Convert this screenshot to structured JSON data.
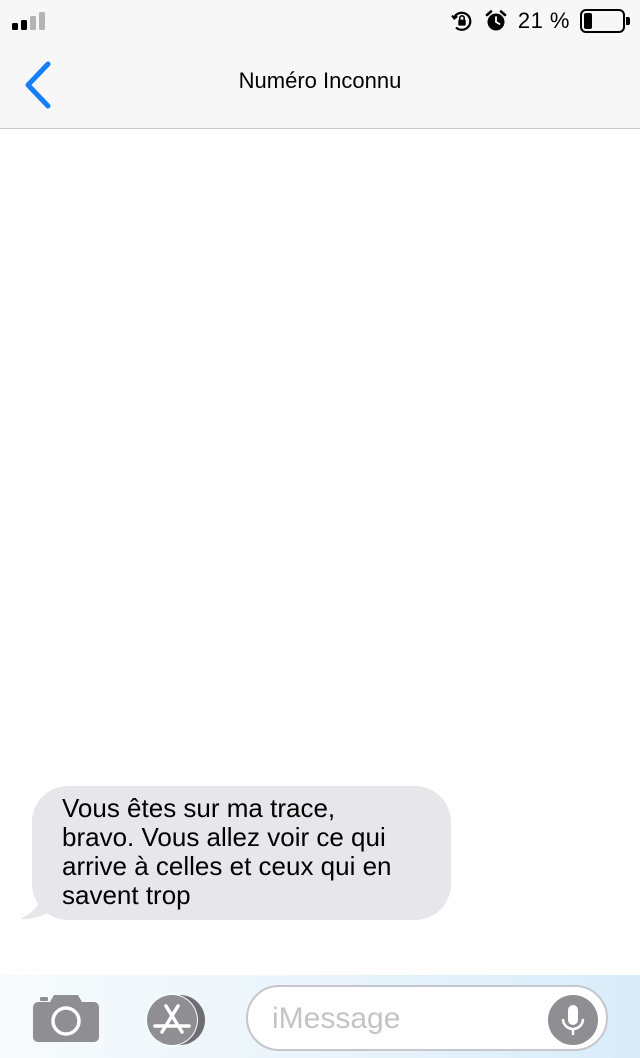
{
  "status_bar": {
    "battery_text": "21 %",
    "battery_level": 0.21,
    "signal_bars_active": 2,
    "signal_bars_total": 4,
    "icons": [
      "signal-bars-icon",
      "orientation-lock-icon",
      "alarm-clock-icon",
      "battery-icon"
    ]
  },
  "nav": {
    "back_icon": "chevron-left-icon",
    "title": "Numéro Inconnu"
  },
  "messages": [
    {
      "direction": "incoming",
      "lines": [
        "Vous êtes sur ma trace,",
        "bravo. Vous allez voir ce qui",
        "arrive à celles et ceux qui en",
        "savent trop"
      ]
    }
  ],
  "compose": {
    "camera_icon": "camera-icon",
    "apps_icon": "app-store-icon",
    "placeholder": "iMessage",
    "value": "",
    "mic_icon": "microphone-icon"
  },
  "colors": {
    "accent": "#147efb",
    "incoming_bubble": "#e6e6eb",
    "bar_background": "#f7f7f7",
    "icon_gray": "#8e8e93"
  }
}
